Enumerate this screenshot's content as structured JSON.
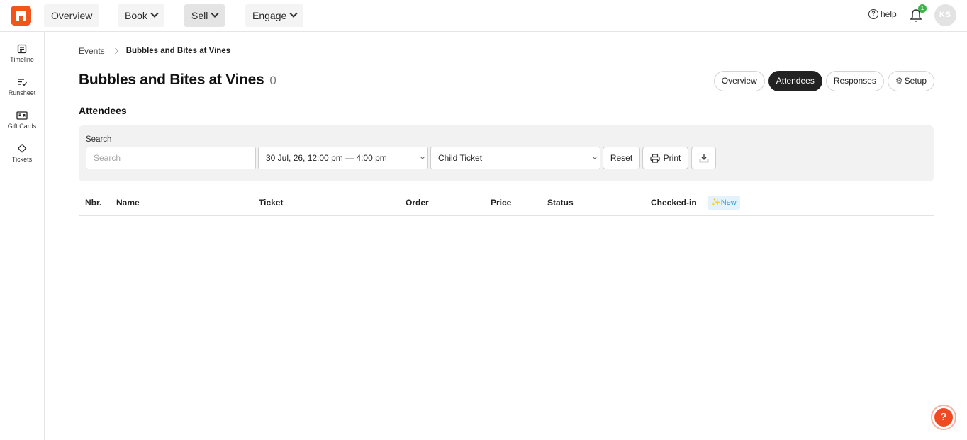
{
  "topbar": {
    "nav": [
      {
        "label": "Overview",
        "has_menu": false
      },
      {
        "label": "Book",
        "has_menu": true
      },
      {
        "label": "Sell",
        "has_menu": true
      },
      {
        "label": "Engage",
        "has_menu": true
      }
    ],
    "help_label": "help",
    "notification_count": "1",
    "avatar_initials": "KS",
    "brand_color": "#f2541b"
  },
  "sidebar": {
    "items": [
      {
        "label": "Timeline",
        "icon": "timeline-icon"
      },
      {
        "label": "Runsheet",
        "icon": "runsheet-icon"
      },
      {
        "label": "Gift Cards",
        "icon": "gift-card-icon"
      },
      {
        "label": "Tickets",
        "icon": "ticket-icon"
      }
    ]
  },
  "breadcrumb": {
    "parent": "Events",
    "current": "Bubbles and Bites at Vines"
  },
  "page": {
    "title": "Bubbles and Bites at Vines",
    "count": "0",
    "section_title": "Attendees"
  },
  "tabs": [
    {
      "label": "Overview",
      "active": false
    },
    {
      "label": "Attendees",
      "active": true
    },
    {
      "label": "Responses",
      "active": false
    },
    {
      "label": "Setup",
      "active": false,
      "icon": "gear-icon"
    }
  ],
  "filters": {
    "search_label": "Search",
    "search_placeholder": "Search",
    "search_value": "",
    "session_value": "30 Jul, 26, 12:00 pm — 4:00 pm",
    "ticket_value": "Child Ticket",
    "reset_label": "Reset",
    "print_label": "Print"
  },
  "table": {
    "columns": [
      "Nbr.",
      "Name",
      "Ticket",
      "Order",
      "Price",
      "Status",
      "Checked-in"
    ],
    "new_badge": "✨New",
    "rows": []
  },
  "help_fab_label": "?"
}
